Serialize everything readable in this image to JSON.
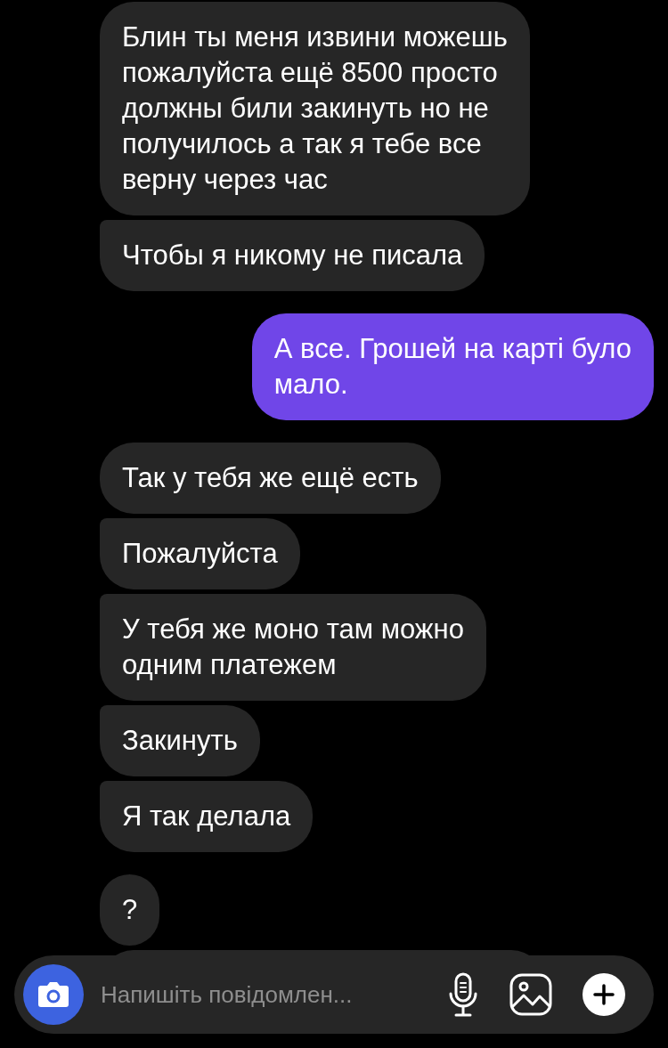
{
  "messages": [
    {
      "kind": "incoming",
      "group_start": true,
      "text": "Блин ты меня извини можешь\nпожалуйста ещё 8500 просто\nдолжны били закинуть но не\nполучилось а так я тебе все\nверну через час"
    },
    {
      "kind": "incoming",
      "group_start": false,
      "text": "Чтобы я никому не писала"
    },
    {
      "kind": "outgoing",
      "group_start": true,
      "text": "А все. Грошей на карті було\nмало."
    },
    {
      "kind": "incoming",
      "group_start": true,
      "text": "Так у тебя же ещё есть"
    },
    {
      "kind": "incoming",
      "group_start": false,
      "text": "Пожалуйста"
    },
    {
      "kind": "incoming",
      "group_start": false,
      "text": "У тебя же моно там можно\nодним платежем"
    },
    {
      "kind": "incoming",
      "group_start": false,
      "text": "Закинуть"
    },
    {
      "kind": "incoming",
      "group_start": false,
      "text": "Я так делала"
    },
    {
      "kind": "incoming",
      "group_start": true,
      "text": "?"
    }
  ],
  "composer": {
    "placeholder": "Напишіть повідомлен..."
  }
}
